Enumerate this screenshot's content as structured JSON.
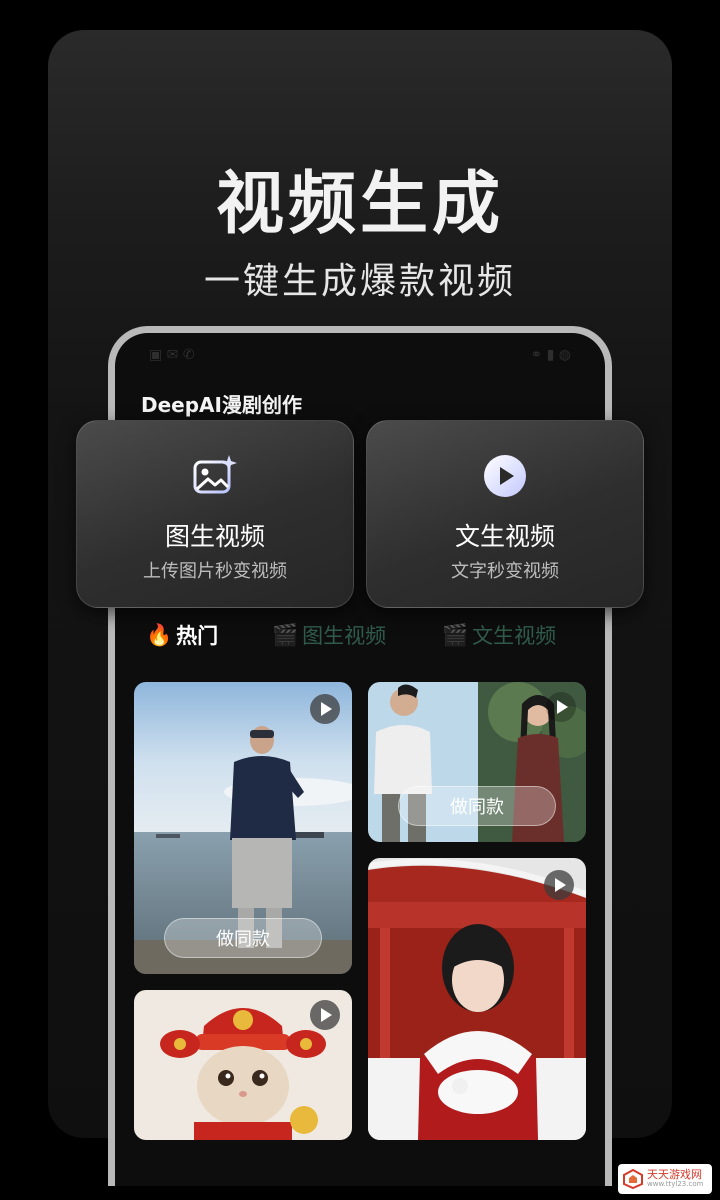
{
  "hero": {
    "title": "视频生成",
    "subtitle": "一键生成爆款视频"
  },
  "phone": {
    "app_title": "DeepAI漫剧创作"
  },
  "features": [
    {
      "title": "图生视频",
      "subtitle": "上传图片秒变视频",
      "icon": "image-sparkle-icon"
    },
    {
      "title": "文生视频",
      "subtitle": "文字秒变视频",
      "icon": "play-circle-icon"
    }
  ],
  "tabs": [
    {
      "label": "热门",
      "emoji": "🔥",
      "active": true
    },
    {
      "label": "图生视频",
      "emoji": "🎬",
      "active": false
    },
    {
      "label": "文生视频",
      "emoji": "🎬",
      "active": false
    }
  ],
  "videos": [
    {
      "scene": "man-by-sea",
      "button": "做同款"
    },
    {
      "scene": "couple-split",
      "button": "做同款"
    },
    {
      "scene": "girl-red-palace",
      "button": ""
    },
    {
      "scene": "cat-god-of-wealth",
      "button": ""
    }
  ],
  "watermark": {
    "text": "天天游戏网",
    "sub": "www.ttyl23.com"
  },
  "colors": {
    "tab_active": "#ffffff",
    "tab_inactive": "#2f5a4a",
    "accent": "#2ea3a0"
  }
}
